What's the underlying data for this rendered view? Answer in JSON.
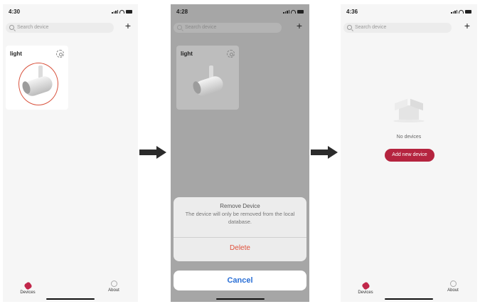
{
  "screens": [
    {
      "status_time": "4:30",
      "search_placeholder": "Search device",
      "device_card": {
        "label": "light"
      },
      "tabs": [
        {
          "label": "Devices"
        },
        {
          "label": "About"
        }
      ]
    },
    {
      "status_time": "4:28",
      "search_placeholder": "Search device",
      "device_card": {
        "label": "light"
      },
      "action_sheet": {
        "title": "Remove Device",
        "message": "The device will only be removed from the local database.",
        "delete_label": "Delete",
        "cancel_label": "Cancel"
      }
    },
    {
      "status_time": "4:36",
      "search_placeholder": "Search device",
      "empty_text": "No devices",
      "add_button_label": "Add new device",
      "tabs": [
        {
          "label": "Devices"
        },
        {
          "label": "About"
        }
      ]
    }
  ],
  "colors": {
    "accent": "#b5243f",
    "delete_red": "#e0503a",
    "cancel_blue": "#2a6fd6",
    "highlight_ring": "#d9543f",
    "dim_overlay": "#a6a6a6"
  },
  "icons": [
    "search-icon",
    "plus-icon",
    "gear-icon",
    "lamp-image",
    "devices-tab-icon",
    "about-tab-icon",
    "arrow-icon",
    "empty-box-icon"
  ]
}
